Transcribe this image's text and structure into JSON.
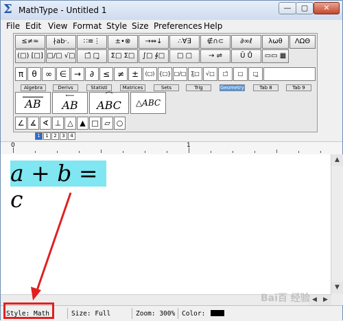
{
  "window": {
    "title": "MathType - Untitled 1",
    "app_icon": "Σ",
    "minimize_glyph": "—",
    "maximize_glyph": "▢",
    "close_glyph": "✕"
  },
  "menu": {
    "items": [
      "File",
      "Edit",
      "View",
      "Format",
      "Style",
      "Size",
      "Preferences",
      "Help"
    ]
  },
  "palette": {
    "row1": [
      "≤≠≈",
      "∤ab·.",
      "∷≡⋮",
      "±•⊗",
      "→⇔↓",
      "∴∀∃",
      "∉∩⊂",
      "∂∞ℓ",
      "λωθ",
      "ΛΩΘ"
    ],
    "row2": [
      "(□) [□]",
      "□/□ √□",
      "□̄ □̰",
      "Σ□ Σ□",
      "∫□ ∮□",
      "□ □",
      "→ ⇌",
      "Ū Ů",
      "▭▭ ▦"
    ],
    "row3": [
      "π",
      "θ",
      "∞",
      "∈",
      "→",
      "∂",
      "≤",
      "≠",
      "±",
      "(□)",
      "{□}",
      "□/□",
      "Σ̲□",
      "√□",
      "□̄",
      "□̱",
      "□̲"
    ],
    "tabs": [
      "Algebra",
      "Derivs",
      "Statisti",
      "Matrices",
      "Sets",
      "Trig",
      "Geometry",
      "Tab 8",
      "Tab 9"
    ],
    "active_tab": "Geometry",
    "templates": [
      "AB",
      "AB",
      "ABC",
      "△ABC"
    ],
    "geometry_symbols": [
      "∠",
      "∡",
      "∢",
      "⊥",
      "△",
      "▲",
      "□",
      "▱",
      "○"
    ]
  },
  "small_toolbar": {
    "buttons": [
      "1",
      "1",
      "2",
      "3",
      "4"
    ]
  },
  "ruler": {
    "labels": [
      "0",
      "1"
    ]
  },
  "editor": {
    "equation": "a + b = c"
  },
  "status": {
    "style_label": "Style: Math",
    "size_label": "Size: Full",
    "zoom_label": "Zoom: 300%",
    "color_label": "Color:",
    "color_value": "#000000"
  },
  "watermark": "Bai百 经验"
}
